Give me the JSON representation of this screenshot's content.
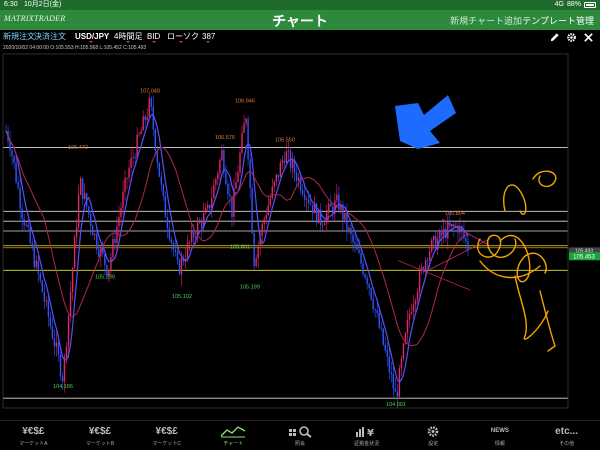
{
  "status_bar": {
    "time": "6:30",
    "date": "10月2日(金)",
    "network": "4G",
    "battery": "88%"
  },
  "header": {
    "logo": "MATRIXTRADER",
    "title": "チャート",
    "add_chart": "新規チャート追加",
    "template": "テンプレート管理"
  },
  "toolbar": {
    "new_order": "新規注文",
    "settle_order": "決済注文",
    "pair": "USD/JPY",
    "timeframe": "4時間足",
    "price_type": "BID",
    "chart_type": "ローソク",
    "count": "387"
  },
  "ohlc": {
    "date": "2020/10/02 04:00:00",
    "open": "O:105.553",
    "high": "H:105.568",
    "low": "L:105.452",
    "close": "C:105.493"
  },
  "chart_data": {
    "type": "candlestick",
    "symbol": "USD/JPY",
    "ylim": [
      103.9,
      107.5
    ],
    "price_labels_high": [
      {
        "value": 106.472
      },
      {
        "value": 107.048
      },
      {
        "value": 106.946
      },
      {
        "value": 106.576
      },
      {
        "value": 106.55
      },
      {
        "value": 105.804
      }
    ],
    "price_labels_low": [
      {
        "value": 105.299
      },
      {
        "value": 105.102
      },
      {
        "value": 105.199
      },
      {
        "value": 105.601
      },
      {
        "value": 104.186
      },
      {
        "value": 104.001
      }
    ],
    "horizontal_lines": [
      106.55,
      105.9,
      105.8,
      105.7,
      105.55,
      105.53,
      105.3,
      104.0
    ],
    "current_price": "105.453",
    "scale_marker": "105.493",
    "colors": {
      "up_candle": "#e0286a",
      "down_candle": "#2f54ff",
      "ma_short": "#5a4dff",
      "ma_long": "#b0284a",
      "level_line": "#d8d8d8",
      "yellow_line": "#e6e62e",
      "orange_line": "#e8900a",
      "high_label": "#e07b3a",
      "low_label": "#58d05a",
      "current_price_bg": "#18a23a",
      "arrow": "#1e6cff",
      "handwriting": "#f0a500"
    }
  },
  "tabs": [
    {
      "label": "マーケットA",
      "icon": "¥€$£"
    },
    {
      "label": "マーケットB",
      "icon": "¥€$£"
    },
    {
      "label": "マーケットC",
      "icon": "¥€$£"
    },
    {
      "label": "チャート",
      "icon": "chart-icon",
      "active": true
    },
    {
      "label": "照会",
      "icon": "search-icon"
    },
    {
      "label": "証拠金状況",
      "icon": "margin-icon"
    },
    {
      "label": "設定",
      "icon": "gear-icon"
    },
    {
      "label": "情報",
      "icon": "NEWS"
    },
    {
      "label": "その他",
      "icon": "etc..."
    }
  ]
}
